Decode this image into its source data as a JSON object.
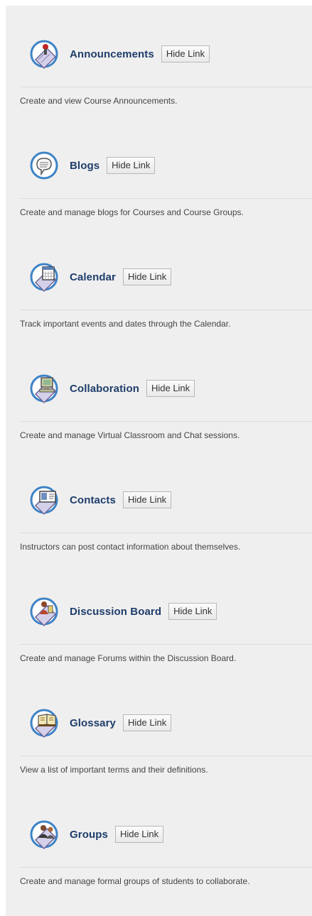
{
  "tools": [
    {
      "icon": "announcement-icon",
      "title": "Announcements",
      "hide_label": "Hide Link",
      "description": "Create and view Course Announcements."
    },
    {
      "icon": "speech-bubble-icon",
      "title": "Blogs",
      "hide_label": "Hide Link",
      "description": "Create and manage blogs for Courses and Course Groups."
    },
    {
      "icon": "calendar-icon",
      "title": "Calendar",
      "hide_label": "Hide Link",
      "description": "Track important events and dates through the Calendar."
    },
    {
      "icon": "computer-icon",
      "title": "Collaboration",
      "hide_label": "Hide Link",
      "description": "Create and manage Virtual Classroom and Chat sessions."
    },
    {
      "icon": "contact-card-icon",
      "title": "Contacts",
      "hide_label": "Hide Link",
      "description": "Instructors can post contact information about themselves."
    },
    {
      "icon": "discussion-icon",
      "title": "Discussion Board",
      "hide_label": "Hide Link",
      "description": "Create and manage Forums within the Discussion Board."
    },
    {
      "icon": "book-icon",
      "title": "Glossary",
      "hide_label": "Hide Link",
      "description": "View a list of important terms and their definitions."
    },
    {
      "icon": "group-icon",
      "title": "Groups",
      "hide_label": "Hide Link",
      "description": "Create and manage formal groups of students to collaborate."
    }
  ],
  "colors": {
    "title": "#1f3d6b",
    "panel_background": "#efefef",
    "description": "#444444"
  }
}
